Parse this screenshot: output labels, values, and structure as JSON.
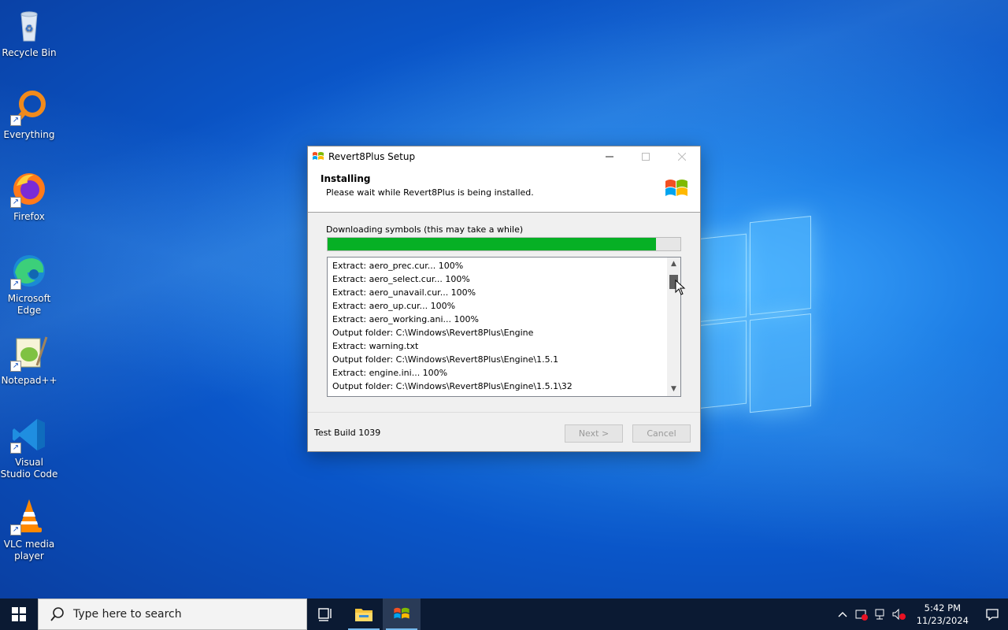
{
  "desktop": {
    "icons": [
      {
        "label": "Recycle Bin"
      },
      {
        "label": "Everything"
      },
      {
        "label": "Firefox"
      },
      {
        "label": "Microsoft Edge"
      },
      {
        "label": "Notepad++"
      },
      {
        "label": "Visual Studio Code"
      },
      {
        "label": "VLC media player"
      }
    ]
  },
  "window": {
    "title": "Revert8Plus Setup",
    "header_title": "Installing",
    "header_subtitle": "Please wait while Revert8Plus is being installed.",
    "status_text": "Downloading symbols (this may take a while)",
    "progress_fraction": 0.93,
    "log_lines": [
      "Extract: aero_prec.cur... 100%",
      "Extract: aero_select.cur... 100%",
      "Extract: aero_unavail.cur... 100%",
      "Extract: aero_up.cur... 100%",
      "Extract: aero_working.ani... 100%",
      "Output folder: C:\\Windows\\Revert8Plus\\Engine",
      "Extract: warning.txt",
      "Output folder: C:\\Windows\\Revert8Plus\\Engine\\1.5.1",
      "Extract: engine.ini... 100%",
      "Output folder: C:\\Windows\\Revert8Plus\\Engine\\1.5.1\\32"
    ],
    "build_label": "Test Build 1039",
    "next_label": "Next >",
    "cancel_label": "Cancel"
  },
  "taskbar": {
    "search_placeholder": "Type here to search",
    "time": "5:42 PM",
    "date": "11/23/2024"
  },
  "colors": {
    "progress": "#06b025",
    "taskbar": "#0b1a33"
  }
}
